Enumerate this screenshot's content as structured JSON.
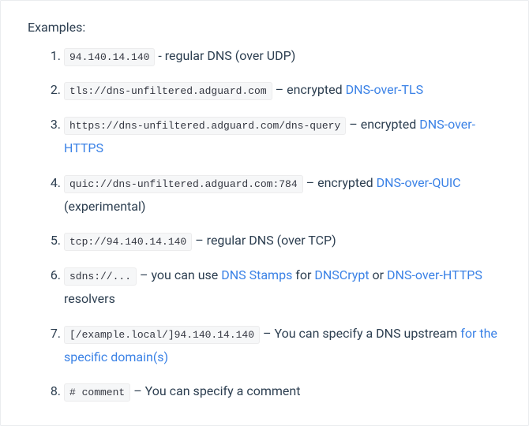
{
  "heading": "Examples:",
  "items": [
    {
      "code": "94.140.14.140",
      "parts": [
        {
          "t": "text",
          "v": " - regular DNS (over UDP)"
        }
      ]
    },
    {
      "code": "tls://dns-unfiltered.adguard.com",
      "parts": [
        {
          "t": "text",
          "v": " – encrypted "
        },
        {
          "t": "link",
          "v": "DNS-over-TLS"
        }
      ]
    },
    {
      "code": "https://dns-unfiltered.adguard.com/dns-query",
      "parts": [
        {
          "t": "text",
          "v": " – encrypted "
        },
        {
          "t": "link",
          "v": "DNS-over-HTTPS"
        }
      ]
    },
    {
      "code": "quic://dns-unfiltered.adguard.com:784",
      "parts": [
        {
          "t": "text",
          "v": " – encrypted "
        },
        {
          "t": "link",
          "v": "DNS-over-QUIC"
        },
        {
          "t": "text",
          "v": " (experimental)"
        }
      ]
    },
    {
      "code": "tcp://94.140.14.140",
      "parts": [
        {
          "t": "text",
          "v": " – regular DNS (over TCP)"
        }
      ]
    },
    {
      "code": "sdns://...",
      "parts": [
        {
          "t": "text",
          "v": " – you can use "
        },
        {
          "t": "link",
          "v": "DNS Stamps"
        },
        {
          "t": "text",
          "v": " for "
        },
        {
          "t": "link",
          "v": "DNSCrypt"
        },
        {
          "t": "text",
          "v": " or "
        },
        {
          "t": "link",
          "v": "DNS-over-HTTPS"
        },
        {
          "t": "text",
          "v": " resolvers"
        }
      ]
    },
    {
      "code": "[/example.local/]94.140.14.140",
      "parts": [
        {
          "t": "text",
          "v": " – You can specify a DNS upstream "
        },
        {
          "t": "link",
          "v": "for the specific domain(s)"
        }
      ]
    },
    {
      "code": "# comment",
      "parts": [
        {
          "t": "text",
          "v": " – You can specify a comment"
        }
      ]
    }
  ]
}
